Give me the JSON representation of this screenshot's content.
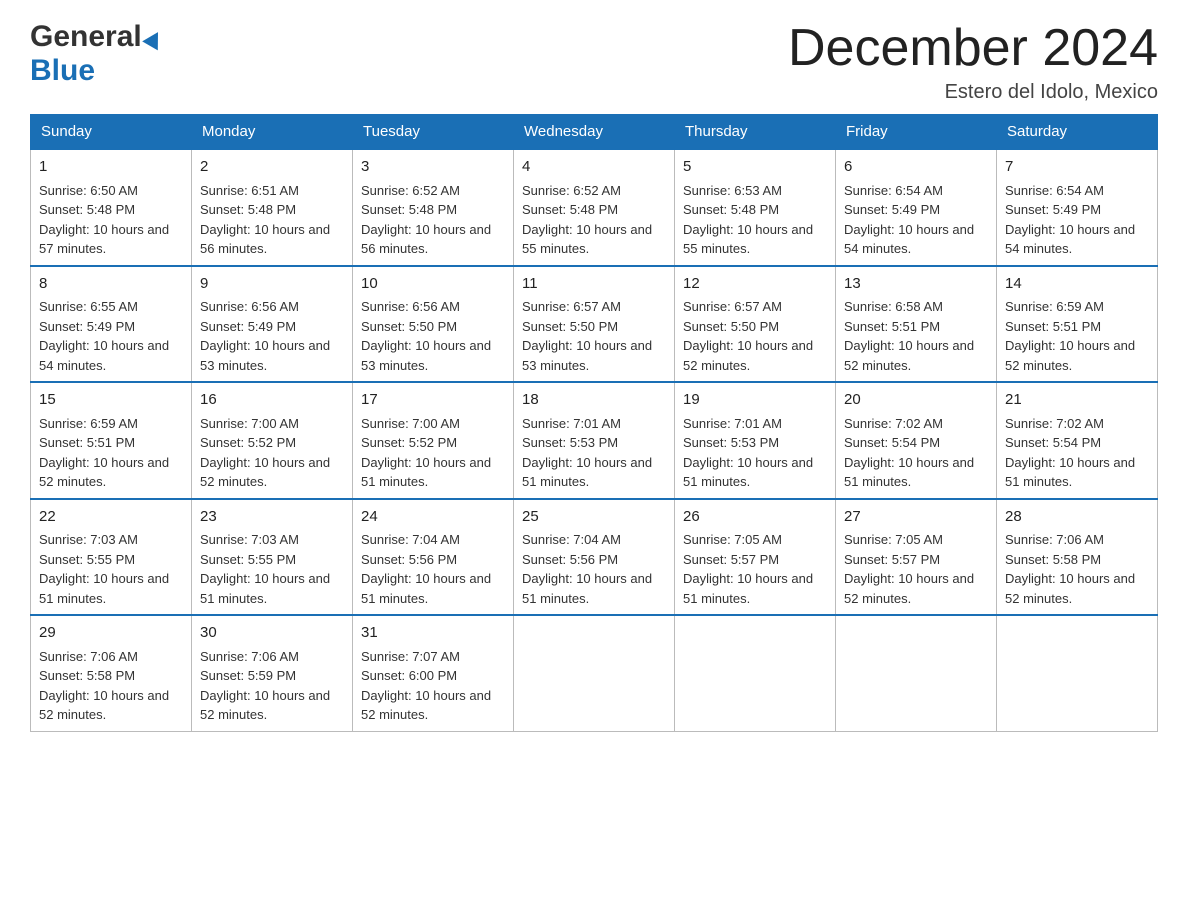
{
  "header": {
    "logo_general": "General",
    "logo_blue": "Blue",
    "month_title": "December 2024",
    "location": "Estero del Idolo, Mexico"
  },
  "weekdays": [
    "Sunday",
    "Monday",
    "Tuesday",
    "Wednesday",
    "Thursday",
    "Friday",
    "Saturday"
  ],
  "weeks": [
    [
      {
        "day": "1",
        "sunrise": "6:50 AM",
        "sunset": "5:48 PM",
        "daylight": "10 hours and 57 minutes."
      },
      {
        "day": "2",
        "sunrise": "6:51 AM",
        "sunset": "5:48 PM",
        "daylight": "10 hours and 56 minutes."
      },
      {
        "day": "3",
        "sunrise": "6:52 AM",
        "sunset": "5:48 PM",
        "daylight": "10 hours and 56 minutes."
      },
      {
        "day": "4",
        "sunrise": "6:52 AM",
        "sunset": "5:48 PM",
        "daylight": "10 hours and 55 minutes."
      },
      {
        "day": "5",
        "sunrise": "6:53 AM",
        "sunset": "5:48 PM",
        "daylight": "10 hours and 55 minutes."
      },
      {
        "day": "6",
        "sunrise": "6:54 AM",
        "sunset": "5:49 PM",
        "daylight": "10 hours and 54 minutes."
      },
      {
        "day": "7",
        "sunrise": "6:54 AM",
        "sunset": "5:49 PM",
        "daylight": "10 hours and 54 minutes."
      }
    ],
    [
      {
        "day": "8",
        "sunrise": "6:55 AM",
        "sunset": "5:49 PM",
        "daylight": "10 hours and 54 minutes."
      },
      {
        "day": "9",
        "sunrise": "6:56 AM",
        "sunset": "5:49 PM",
        "daylight": "10 hours and 53 minutes."
      },
      {
        "day": "10",
        "sunrise": "6:56 AM",
        "sunset": "5:50 PM",
        "daylight": "10 hours and 53 minutes."
      },
      {
        "day": "11",
        "sunrise": "6:57 AM",
        "sunset": "5:50 PM",
        "daylight": "10 hours and 53 minutes."
      },
      {
        "day": "12",
        "sunrise": "6:57 AM",
        "sunset": "5:50 PM",
        "daylight": "10 hours and 52 minutes."
      },
      {
        "day": "13",
        "sunrise": "6:58 AM",
        "sunset": "5:51 PM",
        "daylight": "10 hours and 52 minutes."
      },
      {
        "day": "14",
        "sunrise": "6:59 AM",
        "sunset": "5:51 PM",
        "daylight": "10 hours and 52 minutes."
      }
    ],
    [
      {
        "day": "15",
        "sunrise": "6:59 AM",
        "sunset": "5:51 PM",
        "daylight": "10 hours and 52 minutes."
      },
      {
        "day": "16",
        "sunrise": "7:00 AM",
        "sunset": "5:52 PM",
        "daylight": "10 hours and 52 minutes."
      },
      {
        "day": "17",
        "sunrise": "7:00 AM",
        "sunset": "5:52 PM",
        "daylight": "10 hours and 51 minutes."
      },
      {
        "day": "18",
        "sunrise": "7:01 AM",
        "sunset": "5:53 PM",
        "daylight": "10 hours and 51 minutes."
      },
      {
        "day": "19",
        "sunrise": "7:01 AM",
        "sunset": "5:53 PM",
        "daylight": "10 hours and 51 minutes."
      },
      {
        "day": "20",
        "sunrise": "7:02 AM",
        "sunset": "5:54 PM",
        "daylight": "10 hours and 51 minutes."
      },
      {
        "day": "21",
        "sunrise": "7:02 AM",
        "sunset": "5:54 PM",
        "daylight": "10 hours and 51 minutes."
      }
    ],
    [
      {
        "day": "22",
        "sunrise": "7:03 AM",
        "sunset": "5:55 PM",
        "daylight": "10 hours and 51 minutes."
      },
      {
        "day": "23",
        "sunrise": "7:03 AM",
        "sunset": "5:55 PM",
        "daylight": "10 hours and 51 minutes."
      },
      {
        "day": "24",
        "sunrise": "7:04 AM",
        "sunset": "5:56 PM",
        "daylight": "10 hours and 51 minutes."
      },
      {
        "day": "25",
        "sunrise": "7:04 AM",
        "sunset": "5:56 PM",
        "daylight": "10 hours and 51 minutes."
      },
      {
        "day": "26",
        "sunrise": "7:05 AM",
        "sunset": "5:57 PM",
        "daylight": "10 hours and 51 minutes."
      },
      {
        "day": "27",
        "sunrise": "7:05 AM",
        "sunset": "5:57 PM",
        "daylight": "10 hours and 52 minutes."
      },
      {
        "day": "28",
        "sunrise": "7:06 AM",
        "sunset": "5:58 PM",
        "daylight": "10 hours and 52 minutes."
      }
    ],
    [
      {
        "day": "29",
        "sunrise": "7:06 AM",
        "sunset": "5:58 PM",
        "daylight": "10 hours and 52 minutes."
      },
      {
        "day": "30",
        "sunrise": "7:06 AM",
        "sunset": "5:59 PM",
        "daylight": "10 hours and 52 minutes."
      },
      {
        "day": "31",
        "sunrise": "7:07 AM",
        "sunset": "6:00 PM",
        "daylight": "10 hours and 52 minutes."
      },
      null,
      null,
      null,
      null
    ]
  ]
}
